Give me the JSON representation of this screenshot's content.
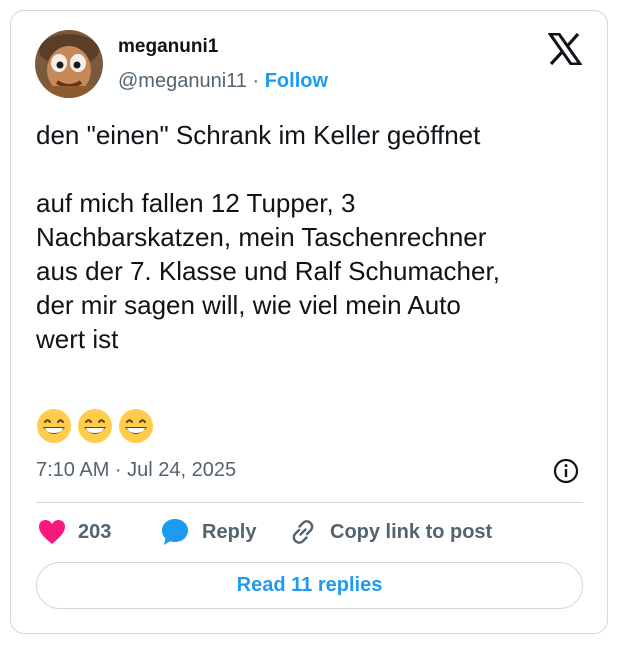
{
  "author": {
    "display_name": "meganuni1",
    "handle": "@meganuni11",
    "separator": "·",
    "follow_label": "Follow",
    "avatar_icon": "muppet-avatar-icon"
  },
  "brand": {
    "logo_icon": "x-logo-icon"
  },
  "tweet": {
    "text": "den \"einen\" Schrank im Keller geöffnet\n\nauf mich fallen 12 Tupper, 3\nNachbarskatzen,  mein Taschenrechner\naus der 7. Klasse und Ralf Schumacher,\nder mir sagen will, wie viel mein Auto\nwert ist",
    "emojis": [
      "grinning-face-icon",
      "grinning-face-icon",
      "grinning-face-icon"
    ],
    "timestamp": "7:10 AM · Jul 24, 2025"
  },
  "actions": {
    "like_count": "203",
    "reply_label": "Reply",
    "copy_label": "Copy link to post"
  },
  "footer": {
    "read_replies_label": "Read 11 replies"
  },
  "colors": {
    "accent": "#1d9bf0",
    "heart": "#f91880",
    "text": "#0f1419",
    "muted": "#536471",
    "border": "#cfd9de"
  }
}
